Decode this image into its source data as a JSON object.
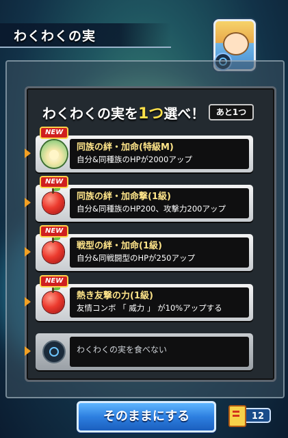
{
  "header": {
    "title": "わくわくの実"
  },
  "panel": {
    "prompt_prefix": "わくわくの実を",
    "prompt_highlight": "1つ",
    "prompt_suffix": "選べ！",
    "remaining": "あと1つ"
  },
  "options": [
    {
      "badge": "NEW",
      "name": "同族の絆・加命(特級M)",
      "desc": "自分&同種族のHPが2000アップ",
      "icon": "lotus-fruit-icon"
    },
    {
      "badge": "NEW",
      "name": "同族の絆・加命撃(1級)",
      "desc": "自分&同種族のHP200、攻撃力200アップ",
      "icon": "red-fruit-icon"
    },
    {
      "badge": "NEW",
      "name": "戦型の絆・加命(1級)",
      "desc": "自分&同戦闘型のHPが250アップ",
      "icon": "red-fruit-icon"
    },
    {
      "badge": "NEW",
      "name": "熱き友撃の力(1級)",
      "desc": "友情コンボ 「 威力 」 が10%アップする",
      "icon": "red-fruit-icon"
    }
  ],
  "no_eat": {
    "label": "わくわくの実を食べない",
    "icon": "empty-orb-icon"
  },
  "footer": {
    "keep_label": "そのままにする",
    "ticket_count": "12"
  },
  "colors": {
    "highlight": "#ffe14a",
    "option_name": "#ffe58a",
    "badge_red": "#d01f1f",
    "button_blue": "#2d7fe0"
  }
}
